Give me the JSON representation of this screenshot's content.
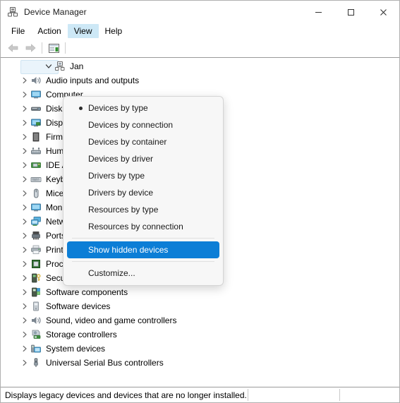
{
  "window": {
    "title": "Device Manager",
    "icon": "device-manager-icon",
    "caption": {
      "minimize": "—",
      "maximize": "☐",
      "close": "✕"
    }
  },
  "menubar": {
    "items": [
      {
        "label": "File",
        "active": false
      },
      {
        "label": "Action",
        "active": false
      },
      {
        "label": "View",
        "active": true
      },
      {
        "label": "Help",
        "active": false
      }
    ]
  },
  "toolbar": {
    "back": "back-arrow",
    "forward": "forward-arrow",
    "properties": "properties-icon"
  },
  "view_menu": {
    "items": [
      {
        "label": "Devices by type",
        "checked": true,
        "highlighted": false
      },
      {
        "label": "Devices by connection",
        "checked": false,
        "highlighted": false
      },
      {
        "label": "Devices by container",
        "checked": false,
        "highlighted": false
      },
      {
        "label": "Devices by driver",
        "checked": false,
        "highlighted": false
      },
      {
        "label": "Drivers by type",
        "checked": false,
        "highlighted": false
      },
      {
        "label": "Drivers by device",
        "checked": false,
        "highlighted": false
      },
      {
        "label": "Resources by type",
        "checked": false,
        "highlighted": false
      },
      {
        "label": "Resources by connection",
        "checked": false,
        "highlighted": false
      },
      {
        "separator": true
      },
      {
        "label": "Show hidden devices",
        "checked": false,
        "highlighted": true
      },
      {
        "separator": true
      },
      {
        "label": "Customize...",
        "checked": false,
        "highlighted": false
      }
    ],
    "highlight_color": "#0c7ed6"
  },
  "tree": {
    "root": {
      "label": "Jan",
      "expanded": true,
      "selected": true,
      "icon": "computer-icon"
    },
    "children": [
      {
        "label": "Audio inputs and outputs",
        "icon": "speaker-icon"
      },
      {
        "label": "Computer",
        "icon": "monitor-icon"
      },
      {
        "label": "Disk drives",
        "icon": "disk-icon"
      },
      {
        "label": "Display adapters",
        "icon": "display-adapter-icon"
      },
      {
        "label": "Firmware",
        "icon": "firmware-icon"
      },
      {
        "label": "Human Interface Devices",
        "icon": "hid-icon"
      },
      {
        "label": "IDE ATA/ATAPI controllers",
        "icon": "ide-controller-icon"
      },
      {
        "label": "Keyboards",
        "icon": "keyboard-icon"
      },
      {
        "label": "Mice and other pointing devices",
        "icon": "mouse-icon"
      },
      {
        "label": "Monitors",
        "icon": "monitor-icon"
      },
      {
        "label": "Network adapters",
        "icon": "network-adapter-icon"
      },
      {
        "label": "Ports (COM & LPT)",
        "icon": "port-icon"
      },
      {
        "label": "Print queues",
        "icon": "printer-icon"
      },
      {
        "label": "Processors",
        "icon": "processor-icon"
      },
      {
        "label": "Security devices",
        "icon": "security-device-icon"
      },
      {
        "label": "Software components",
        "icon": "software-component-icon"
      },
      {
        "label": "Software devices",
        "icon": "software-device-icon"
      },
      {
        "label": "Sound, video and game controllers",
        "icon": "speaker-icon"
      },
      {
        "label": "Storage controllers",
        "icon": "storage-controller-icon"
      },
      {
        "label": "System devices",
        "icon": "system-device-icon"
      },
      {
        "label": "Universal Serial Bus controllers",
        "icon": "usb-icon"
      }
    ],
    "expander_collapsed": "›",
    "expander_expanded": "⌄"
  },
  "statusbar": {
    "text": "Displays legacy devices and devices that are no longer installed."
  }
}
